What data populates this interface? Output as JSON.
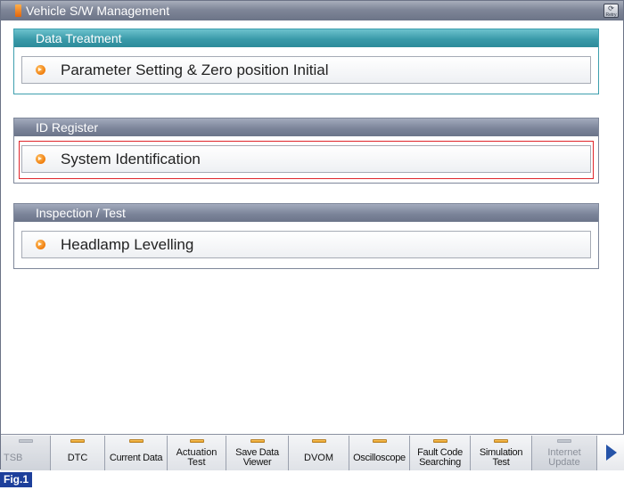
{
  "window": {
    "title": "Vehicle S/W Management",
    "retry_label": "Retry"
  },
  "groups": [
    {
      "header": "Data Treatment",
      "items": [
        "Parameter Setting & Zero position Initial"
      ]
    },
    {
      "header": "ID Register",
      "items": [
        "System Identification"
      ],
      "selected": "System Identification"
    },
    {
      "header": "Inspection / Test",
      "items": [
        "Headlamp Levelling"
      ]
    }
  ],
  "toolbar": {
    "buttons": [
      {
        "label": "TSB",
        "enabled": false
      },
      {
        "label": "DTC",
        "enabled": true
      },
      {
        "label": "Current Data",
        "enabled": true
      },
      {
        "label": "Actuation Test",
        "enabled": true
      },
      {
        "label": "Save Data Viewer",
        "enabled": true
      },
      {
        "label": "DVOM",
        "enabled": true
      },
      {
        "label": "Oscilloscope",
        "enabled": true
      },
      {
        "label": "Fault Code Searching",
        "enabled": true
      },
      {
        "label": "Simulation Test",
        "enabled": true
      },
      {
        "label": "Internet Update",
        "enabled": false
      }
    ],
    "next_icon": "arrow-right-icon"
  },
  "figure_label": "Fig.1",
  "colors": {
    "title_bar": "#7f8698",
    "teal_header": "#3a9aa9",
    "slate_header": "#7c859a",
    "selection": "#e0262b",
    "bullet": "#f07d0c",
    "figure_label_bg": "#1d3f9b"
  }
}
